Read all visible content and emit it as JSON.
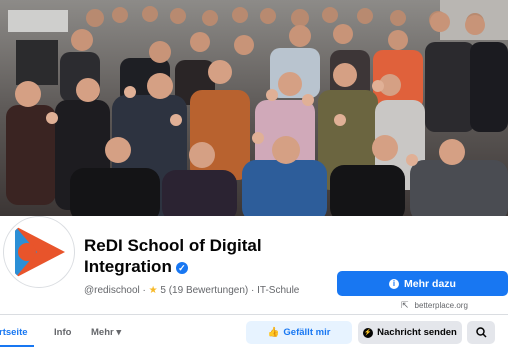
{
  "page": {
    "name": "ReDI School of Digital Integration",
    "handle": "@redischool",
    "rating_text": "5 (19 Bewertungen)",
    "category": "IT-Schule"
  },
  "actions": {
    "primary_label": "Mehr dazu",
    "external_link": "betterplace.org",
    "like_label": "Gefällt mir",
    "message_label": "Nachricht senden"
  },
  "tabs": [
    {
      "label": "rtseite"
    },
    {
      "label": "Info"
    },
    {
      "label": "Mehr"
    }
  ],
  "colors": {
    "accent": "#1877f2",
    "logo_orange": "#e8542b",
    "logo_blue": "#2b8fd6"
  }
}
